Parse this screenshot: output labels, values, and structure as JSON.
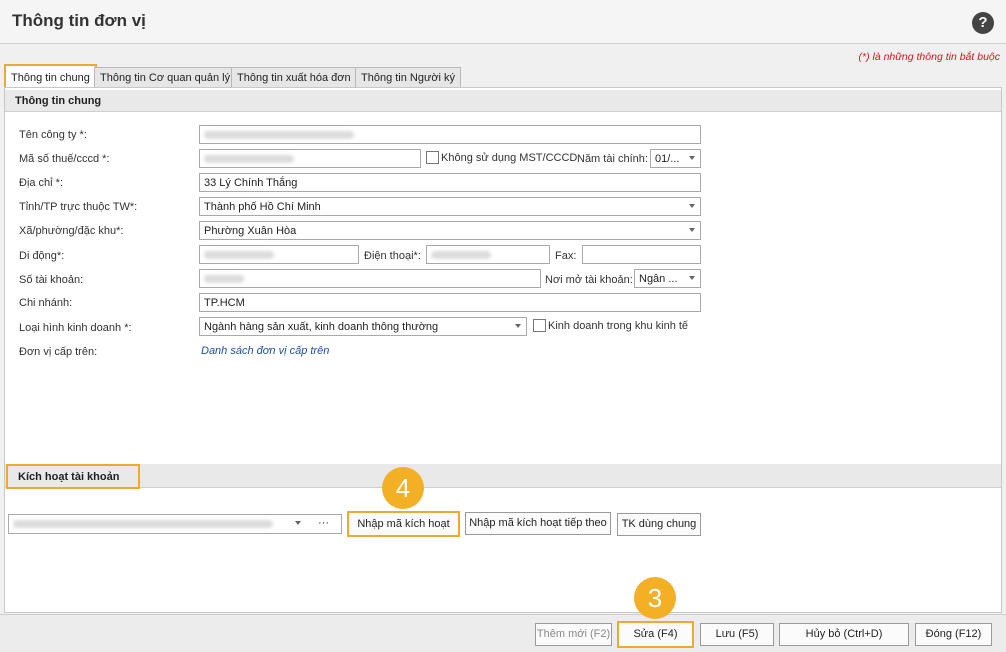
{
  "window": {
    "title": "Thông tin đơn vị",
    "help_icon": "?"
  },
  "required_note": "(*) là những thông tin bắt buộc",
  "tabs": [
    {
      "label": "Thông tin chung",
      "active": true
    },
    {
      "label": "Thông tin Cơ quan quản lý",
      "active": false
    },
    {
      "label": "Thông tin xuất hóa đơn",
      "active": false
    },
    {
      "label": "Thông tin Người ký",
      "active": false
    }
  ],
  "general": {
    "section_title": "Thông tin chung",
    "company_name": {
      "label": "Tên công ty *:",
      "value": ""
    },
    "tax_code": {
      "label": "Mã số thuế/cccd *:",
      "value": ""
    },
    "no_mst": {
      "label": "Không sử dụng MST/CCCD",
      "checked": false
    },
    "fiscal_year": {
      "label": "Năm tài chính:",
      "value": "01/..."
    },
    "address": {
      "label": "Địa chỉ *:",
      "value": "33 Lý Chính Thắng"
    },
    "province": {
      "label": "Tỉnh/TP trực thuộc TW*:",
      "value": "Thành phố Hồ Chí Minh"
    },
    "ward": {
      "label": "Xã/phường/đặc khu*:",
      "value": "Phường Xuân Hòa"
    },
    "mobile": {
      "label": "Di động*:",
      "value": ""
    },
    "phone": {
      "label": "Điện thoại*:",
      "value": ""
    },
    "fax": {
      "label": "Fax:",
      "value": ""
    },
    "account_no": {
      "label": "Số tài khoản:",
      "value": ""
    },
    "bank": {
      "label": "Nơi mở tài khoản:",
      "value": "Ngân ..."
    },
    "branch": {
      "label": "Chi nhánh:",
      "value": "TP.HCM"
    },
    "business_type": {
      "label": "Loại hình kinh doanh *:",
      "value": "Ngành hàng sản xuất, kinh doanh thông thường"
    },
    "economic_zone": {
      "label": "Kinh doanh trong khu kinh tế",
      "checked": false
    },
    "parent_unit": {
      "label": "Đơn vị cấp trên:",
      "link": "Danh sách đơn vị cấp trên"
    }
  },
  "activation": {
    "section_title": "Kích hoạt tài khoản",
    "account_select_value": "",
    "more_label": "···",
    "enter_code_button": "Nhập mã kích hoạt",
    "enter_next_code_button": "Nhập mã kích hoạt tiếp theo",
    "shared_account_button": "TK dùng chung",
    "step_badge": "4"
  },
  "footer": {
    "step_badge": "3",
    "add_button": "Thêm mới (F2)",
    "edit_button": "Sửa (F4)",
    "save_button": "Lưu (F5)",
    "cancel_button": "Hủy bỏ (Ctrl+D)",
    "close_button": "Đóng (F12)"
  },
  "colors": {
    "highlight": "#f0a830",
    "badge": "#f4b025",
    "required": "#d01818",
    "link": "#1c4f9c"
  }
}
